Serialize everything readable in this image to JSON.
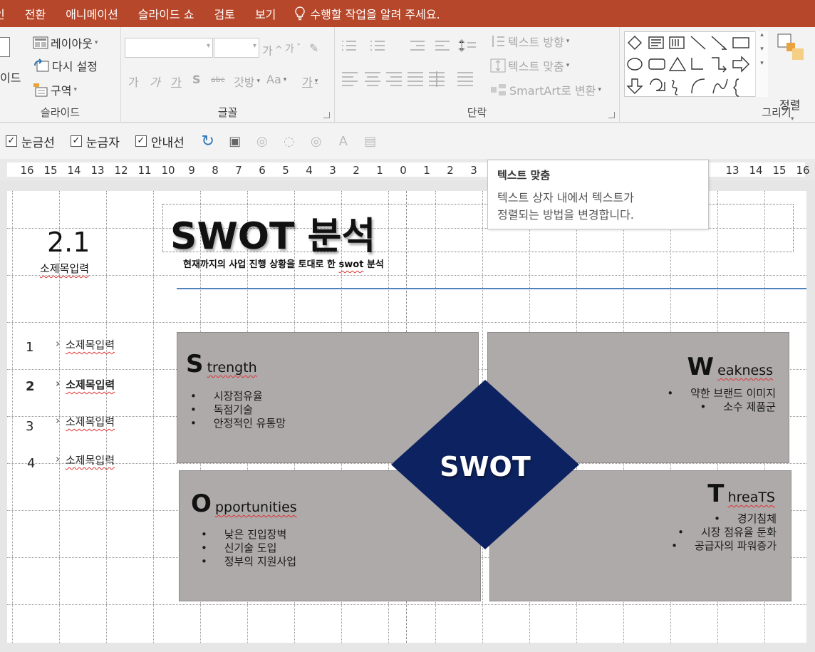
{
  "menu": {
    "tabs": [
      "인",
      "전환",
      "애니메이션",
      "슬라이드 쇼",
      "검토",
      "보기"
    ],
    "tell_me": "수행할 작업을 알려 주세요."
  },
  "ribbon": {
    "slides": {
      "layout_label": "레이아웃",
      "reset_label": "다시 설정",
      "section_label": "구역",
      "new_slide_fragment": "이드",
      "group_label": "슬라이드"
    },
    "font": {
      "grow": "가",
      "shrink": "가",
      "bold": "가",
      "italic": "가",
      "underline": "가",
      "shadow": "S",
      "strike": "abc",
      "spacing": "갓방",
      "case": "Aa",
      "color": "가",
      "group_label": "글꼴"
    },
    "paragraph": {
      "text_direction": "텍스트 방향",
      "align_text": "텍스트 맞춤",
      "smartart": "SmartArt로 변환",
      "group_label": "단락"
    },
    "drawing": {
      "arrange_label": "정렬",
      "group_label": "그리기"
    }
  },
  "quickbar": {
    "gridlines": "눈금선",
    "ruler": "눈금자",
    "guides": "안내선"
  },
  "ruler": {
    "ticks": [
      "16",
      "15",
      "14",
      "13",
      "12",
      "11",
      "10",
      "9",
      "8",
      "7",
      "6",
      "5",
      "4",
      "3",
      "2",
      "1",
      "0",
      "1",
      "2",
      "3",
      "",
      "",
      "",
      "",
      "",
      "",
      "",
      "",
      "",
      "",
      "13",
      "14",
      "15",
      "16"
    ]
  },
  "tooltip": {
    "title": "텍스트 맞춤",
    "line1": "텍스트 상자 내에서 텍스트가",
    "line2": "정렬되는 방법을 변경합니다."
  },
  "slide": {
    "section_number": "2.1",
    "section_sub": "소제목입력",
    "toc": [
      {
        "num": "1",
        "label": "소제목입력"
      },
      {
        "num": "2",
        "label": "소제목입력"
      },
      {
        "num": "3",
        "label": "소제목입력"
      },
      {
        "num": "4",
        "label": "소제목입력"
      }
    ],
    "title": "SWOT 분석",
    "subtitle_pre": "현재까지의 사업 진행 상황을 토대로 한 ",
    "subtitle_swot": "swot",
    "subtitle_post": " 분석",
    "center_label": "SWOT",
    "strength": {
      "initial": "S",
      "rest": "trength",
      "items": [
        "시장점유율",
        "독점기술",
        "안정적인 유통망"
      ]
    },
    "weakness": {
      "initial": "W",
      "rest": "eakness",
      "items": [
        "약한 브랜드 이미지",
        "소수 제품군"
      ]
    },
    "opportunities": {
      "initial": "O",
      "rest": "pportunities",
      "items": [
        "낮은 진입장벽",
        "신기술 도입",
        "정부의 지원사업"
      ]
    },
    "threats": {
      "initial": "T",
      "rest": "hreaTS",
      "items": [
        "경기침체",
        "시장 점유율 둔화",
        "공급자의 파워증가"
      ]
    }
  },
  "colors": {
    "menubar": "#b7472a",
    "diamond": "#0d2260",
    "quadrant": "#aeaaaa",
    "accent_line": "#4f81bd"
  }
}
